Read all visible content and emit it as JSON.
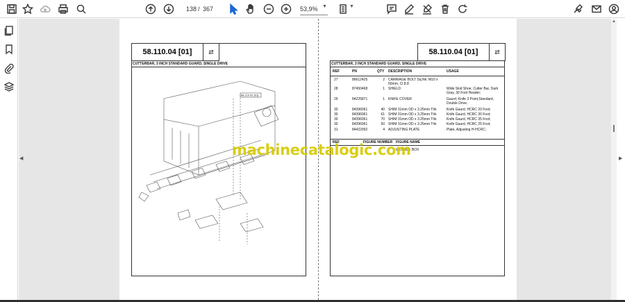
{
  "toolbar": {
    "current_page": "138",
    "page_separator": "/",
    "total_pages": "367",
    "zoom": "53,9%"
  },
  "document": {
    "left_title": "58.110.04 [01]",
    "right_title": "58.110.04 [01]",
    "left_subtitle": "CUTTERBAR, 3 INCH STANDARD GUARD, SINGLE DRIVE",
    "right_subtitle": "CUTTERBAR, 3 INCH STANDARD GUARD, SINGLE DRIVE",
    "link_symbol": "⇄",
    "diagram_tag": "88 110 02 [01]",
    "columns": {
      "ref": "REF",
      "pn": "PN",
      "qty": "QTY",
      "description": "DESCRIPTION",
      "usage": "USAGE"
    },
    "parts": [
      {
        "ref": "27",
        "pn": "86612425",
        "qty": "2",
        "description": "CARRIAGE BOLT Sq.Nk. M10 x 50mm, Cl.8.8",
        "usage": ""
      },
      {
        "ref": "28",
        "pn": "87450468",
        "qty": "1",
        "description": "SHIELD",
        "usage": "Wide Skid Shoe, Cutter Bar, Dark Gray, 30 Foot Header;"
      },
      {
        "ref": "29",
        "pn": "84225871",
        "qty": "1",
        "description": "KNIFE COVER",
        "usage": "Gaurd, Knife 3 Point,Standard, Double Drive;"
      },
      {
        "ref": "30",
        "pn": "84396061",
        "qty": "40",
        "description": "SHIM 31mm OD x 3.25mm Thk",
        "usage": "Knife Gaurd, HCRC 20 Foot;"
      },
      {
        "ref": "30",
        "pn": "84396061",
        "qty": "61",
        "description": "SHIM 31mm OD x 3.25mm Thk",
        "usage": "Knife Gaurd, HCRC 30 Foot;"
      },
      {
        "ref": "30",
        "pn": "84396061",
        "qty": "70",
        "description": "SHIM 31mm OD x 3.25mm Thk",
        "usage": "Knife Gaurd, HCRC 35 Foot;"
      },
      {
        "ref": "30",
        "pn": "84396061",
        "qty": "50",
        "description": "SHIM 31mm OD x 3.25mm Thk",
        "usage": "Knife Gaurd, HCRC 25 Foot;"
      },
      {
        "ref": "31",
        "pn": "84422992",
        "qty": "4",
        "description": "ADJUSTING PLATE",
        "usage": "Plate, Adjusting H-HCRC;"
      }
    ],
    "ref_columns": {
      "ref": "REF",
      "figure_number": "FIGURE NUMBER",
      "figure_name": "FIGURE NAME"
    },
    "figure_refs": [
      {
        "ref": "",
        "figure_number": "",
        "figure_name": "WOBBLE BOX"
      }
    ],
    "watermark": "machinecatalogic.com"
  },
  "icons": {
    "toolbar": [
      "save-icon",
      "bookmark-star-icon",
      "cloud-upload-icon",
      "print-icon",
      "zoom-search-icon",
      "page-up-icon",
      "page-down-icon",
      "select-cursor-icon",
      "hand-pan-icon",
      "zoom-out-icon",
      "zoom-in-icon",
      "fit-page-icon",
      "comment-icon",
      "pen-icon",
      "highlight-icon",
      "delete-icon",
      "rotate-icon",
      "sign-icon",
      "mail-icon",
      "account-icon"
    ],
    "sidebar": [
      "pages-icon",
      "bookmarks-icon",
      "attachments-icon",
      "layers-icon"
    ]
  }
}
